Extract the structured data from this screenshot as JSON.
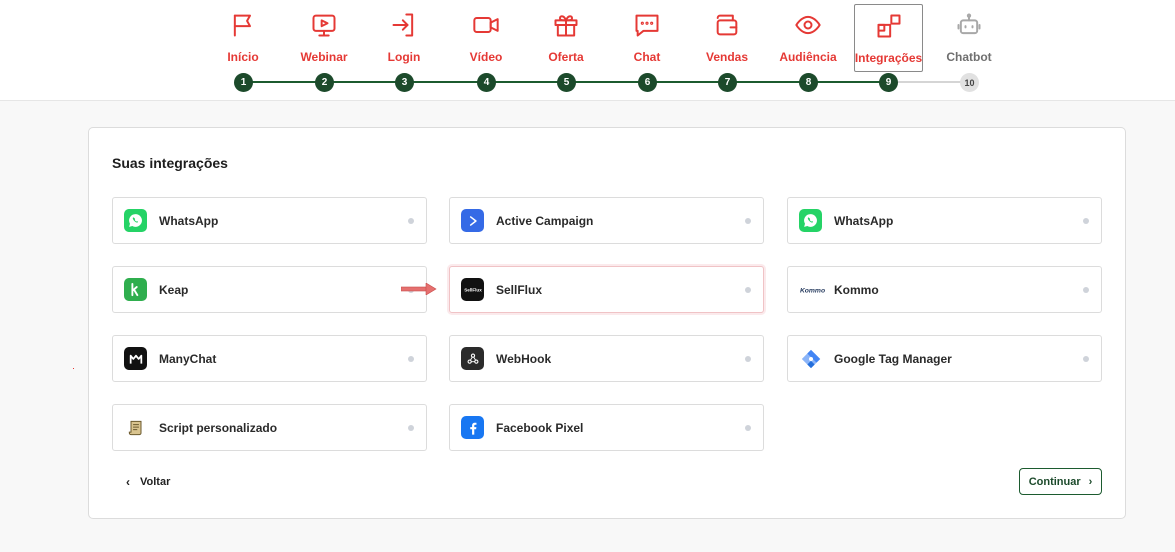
{
  "colors": {
    "brand_red": "#e53935",
    "step_green": "#1c4a2b",
    "track_green": "#1c5b2f",
    "pending_gray": "#a8a8a8"
  },
  "steps": [
    {
      "number": "1",
      "label": "Início",
      "icon": "flag-icon",
      "state": "done"
    },
    {
      "number": "2",
      "label": "Webinar",
      "icon": "play-screen-icon",
      "state": "done"
    },
    {
      "number": "3",
      "label": "Login",
      "icon": "login-icon",
      "state": "done"
    },
    {
      "number": "4",
      "label": "Vídeo",
      "icon": "video-camera-icon",
      "state": "done"
    },
    {
      "number": "5",
      "label": "Oferta",
      "icon": "gift-icon",
      "state": "done"
    },
    {
      "number": "6",
      "label": "Chat",
      "icon": "chat-bubble-icon",
      "state": "done"
    },
    {
      "number": "7",
      "label": "Vendas",
      "icon": "wallet-icon",
      "state": "done"
    },
    {
      "number": "8",
      "label": "Audiência",
      "icon": "eye-icon",
      "state": "done"
    },
    {
      "number": "9",
      "label": "Integrações",
      "icon": "blocks-icon",
      "state": "active"
    },
    {
      "number": "10",
      "label": "Chatbot",
      "icon": "robot-icon",
      "state": "pending"
    }
  ],
  "card": {
    "title": "Suas integrações"
  },
  "integrations": [
    {
      "name": "WhatsApp",
      "icon": "whatsapp-icon"
    },
    {
      "name": "Active Campaign",
      "icon": "active-campaign-icon"
    },
    {
      "name": "WhatsApp",
      "icon": "whatsapp-icon"
    },
    {
      "name": "Keap",
      "icon": "keap-icon"
    },
    {
      "name": "SellFlux",
      "icon": "sellflux-icon",
      "logo_text": "SellFlux"
    },
    {
      "name": "Kommo",
      "icon": "kommo-icon",
      "logo_text": "Kommo"
    },
    {
      "name": "ManyChat",
      "icon": "manychat-icon"
    },
    {
      "name": "WebHook",
      "icon": "webhook-icon"
    },
    {
      "name": "Google Tag Manager",
      "icon": "google-tag-manager-icon"
    },
    {
      "name": "Script personalizado",
      "icon": "script-scroll-icon"
    },
    {
      "name": "Facebook Pixel",
      "icon": "facebook-icon"
    }
  ],
  "actions": {
    "back_label": "Voltar",
    "continue_label": "Continuar"
  }
}
